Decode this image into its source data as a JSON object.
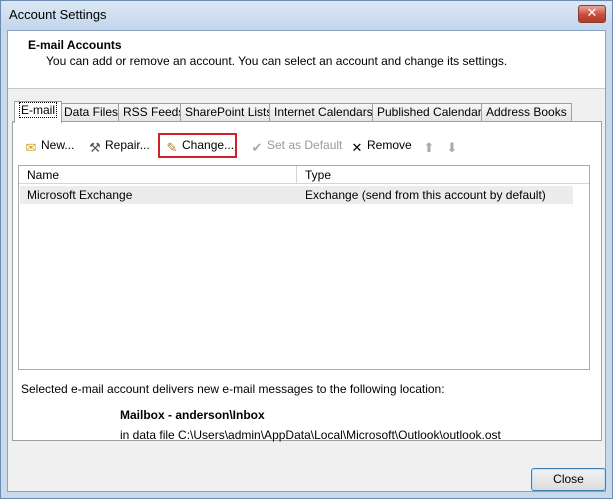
{
  "window": {
    "title": "Account Settings",
    "close_glyph": "✕"
  },
  "header": {
    "title": "E-mail Accounts",
    "subtitle": "You can add or remove an account. You can select an account and change its settings."
  },
  "tabs": [
    {
      "label": "E-mail",
      "active": true
    },
    {
      "label": "Data Files"
    },
    {
      "label": "RSS Feeds"
    },
    {
      "label": "SharePoint Lists"
    },
    {
      "label": "Internet Calendars"
    },
    {
      "label": "Published Calendars"
    },
    {
      "label": "Address Books"
    }
  ],
  "toolbar": {
    "new_label": "New...",
    "repair_label": "Repair...",
    "change_label": "Change...",
    "set_default_label": "Set as Default",
    "remove_label": "Remove",
    "move_up_icon": "arrow-up-icon",
    "move_down_icon": "arrow-down-icon",
    "highlight_color": "#d0202a"
  },
  "accounts_table": {
    "columns": [
      "Name",
      "Type"
    ],
    "rows": [
      {
        "name": "Microsoft Exchange",
        "type": "Exchange (send from this account by default)"
      }
    ]
  },
  "delivery": {
    "description": "Selected e-mail account delivers new e-mail messages to the following location:",
    "mailbox": "Mailbox - anderson\\Inbox",
    "data_file": "in data file C:\\Users\\admin\\AppData\\Local\\Microsoft\\Outlook\\outlook.ost"
  },
  "footer": {
    "close_label": "Close"
  }
}
